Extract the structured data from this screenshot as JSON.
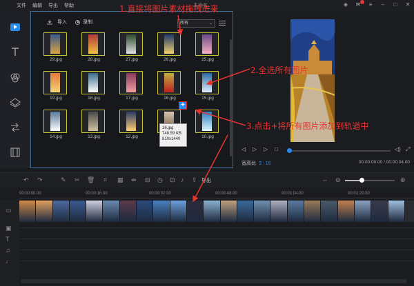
{
  "menu": {
    "items": [
      "文件",
      "编辑",
      "导出",
      "帮助"
    ],
    "window_title": "未命名"
  },
  "sidebar": {
    "tools": [
      "media-icon",
      "text-icon",
      "filter-icon",
      "overlay-icon",
      "transition-icon",
      "film-icon"
    ]
  },
  "media": {
    "import_label": "导入",
    "record_label": "录制",
    "filter_value": "所有",
    "rows": [
      [
        "29.jpg",
        "28.jpg",
        "27.jpg",
        "26.jpg",
        "25.jpg"
      ],
      [
        "19.jpg",
        "18.jpg",
        "17.jpg",
        "16.jpg",
        "15.jpg"
      ],
      [
        "14.jpg",
        "13.jpg",
        "12.jpg",
        "11.jpg",
        "10.jpg"
      ]
    ],
    "tooltip": {
      "name": "16.jpg",
      "size": "748.59 KB",
      "dims": "810x1440"
    },
    "add_glyph": "+"
  },
  "preview": {
    "aspect_label": "宽高比",
    "aspect_value": "9 : 16",
    "timecode": "00:00:00.00 / 00:00:04.00"
  },
  "timeline": {
    "export_label": "导出",
    "ticks": [
      "00:00:00.00",
      "00:00:16.00",
      "00:00:32.00",
      "00:00:48.00",
      "00:01:04.00",
      "00:01:20.00"
    ],
    "clip_count": 23
  },
  "annotations": {
    "step1": "1.直接将图片素材拖拽进来",
    "step2": "2.全选所有图片",
    "step3": "3.点击+将所有图片添加到轨道中"
  },
  "colors": {
    "accent": "#2b8cf0",
    "annotation": "#e7342f",
    "thumb_border": "#c6c330"
  }
}
